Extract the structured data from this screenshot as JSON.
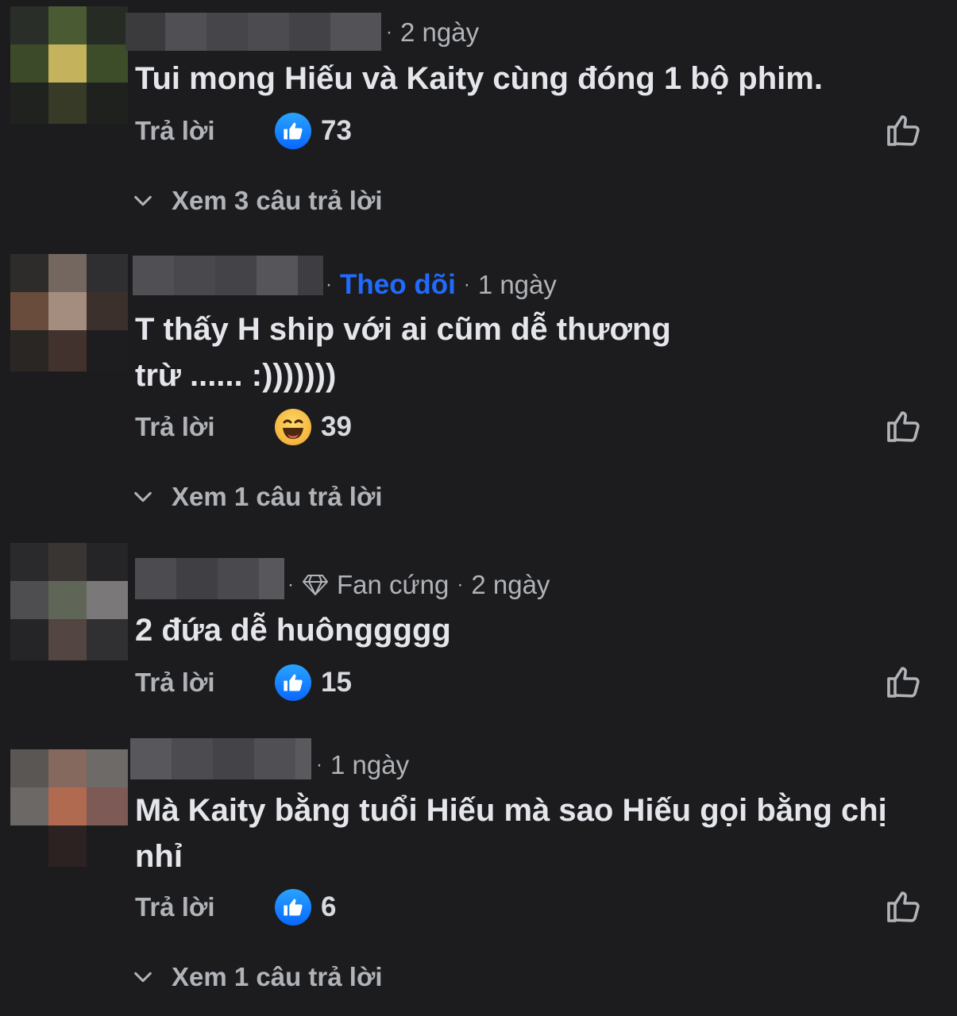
{
  "reply_label": "Trả lời",
  "comments": [
    {
      "time": "2 ngày",
      "follow": "",
      "badge": "",
      "text": "Tui mong Hiếu và Kaity cùng đóng 1 bộ phim.",
      "reaction": "like",
      "count": "73",
      "replies": "Xem 3 câu trả lời"
    },
    {
      "time": "1 ngày",
      "follow": "Theo dõi",
      "badge": "",
      "text_line1": "T thấy H ship với ai cũm dễ thương",
      "text_line2": "trừ ...... :)))))))",
      "reaction": "haha",
      "count": "39",
      "replies": "Xem 1 câu trả lời"
    },
    {
      "time": "2 ngày",
      "follow": "",
      "badge": "Fan cứng",
      "text": "2 đứa dễ huônggggg",
      "reaction": "like",
      "count": "15",
      "replies": ""
    },
    {
      "time": "1 ngày",
      "follow": "",
      "badge": "",
      "text_line1": "Mà Kaity bằng tuổi Hiếu mà sao Hiếu gọi bằng chị",
      "text_line2": "nhỉ",
      "reaction": "like",
      "count": "6",
      "replies": "Xem 1 câu trả lời"
    }
  ],
  "icons": {
    "like_badge": "thumbs-up-icon",
    "haha_badge": "laughing-face-icon",
    "like_button": "thumbs-up-outline-icon",
    "expand": "chevron-down-icon",
    "fan_badge": "diamond-icon"
  },
  "colors": {
    "background": "#1c1c1e",
    "follow": "#1f6bff",
    "like_blue": "#0868ff",
    "muted_text": "#b0b3b8"
  }
}
